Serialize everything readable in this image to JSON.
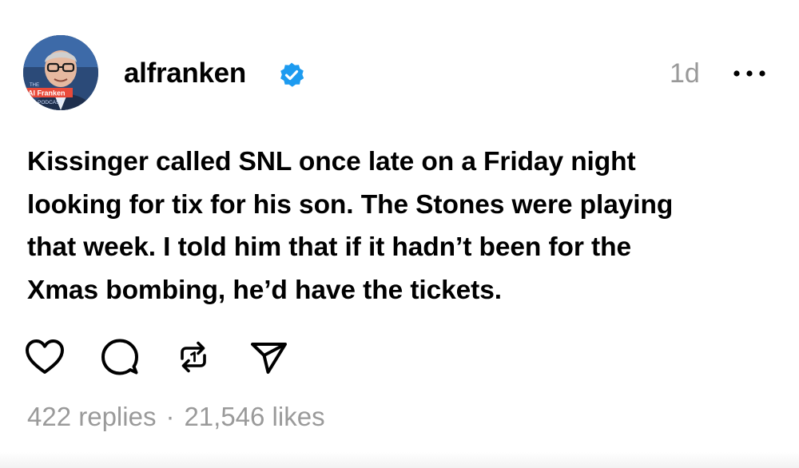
{
  "post": {
    "avatar_label_top": "THE",
    "avatar_label_main": "Al Franken",
    "avatar_label_bottom": "PODCAST",
    "username": "alfranken",
    "verified_icon": "verified-badge-icon",
    "timestamp": "1d",
    "more_icon": "more-options-icon",
    "text": "Kissinger called SNL once late on a Friday night\nlooking for tix for his son. The Stones were playing\nthat week. I told him that if it hadn’t been for the\nXmas bombing, he’d have the tickets.",
    "actions": [
      {
        "icon": "heart-icon"
      },
      {
        "icon": "comment-icon"
      },
      {
        "icon": "repost-icon"
      },
      {
        "icon": "share-icon"
      }
    ],
    "replies": "422 replies",
    "separator": "·",
    "likes": "21,546 likes"
  },
  "colors": {
    "text": "#000000",
    "muted": "#999999",
    "verified": "#1d9bf0",
    "avatar_bg": "#2b4a78"
  }
}
